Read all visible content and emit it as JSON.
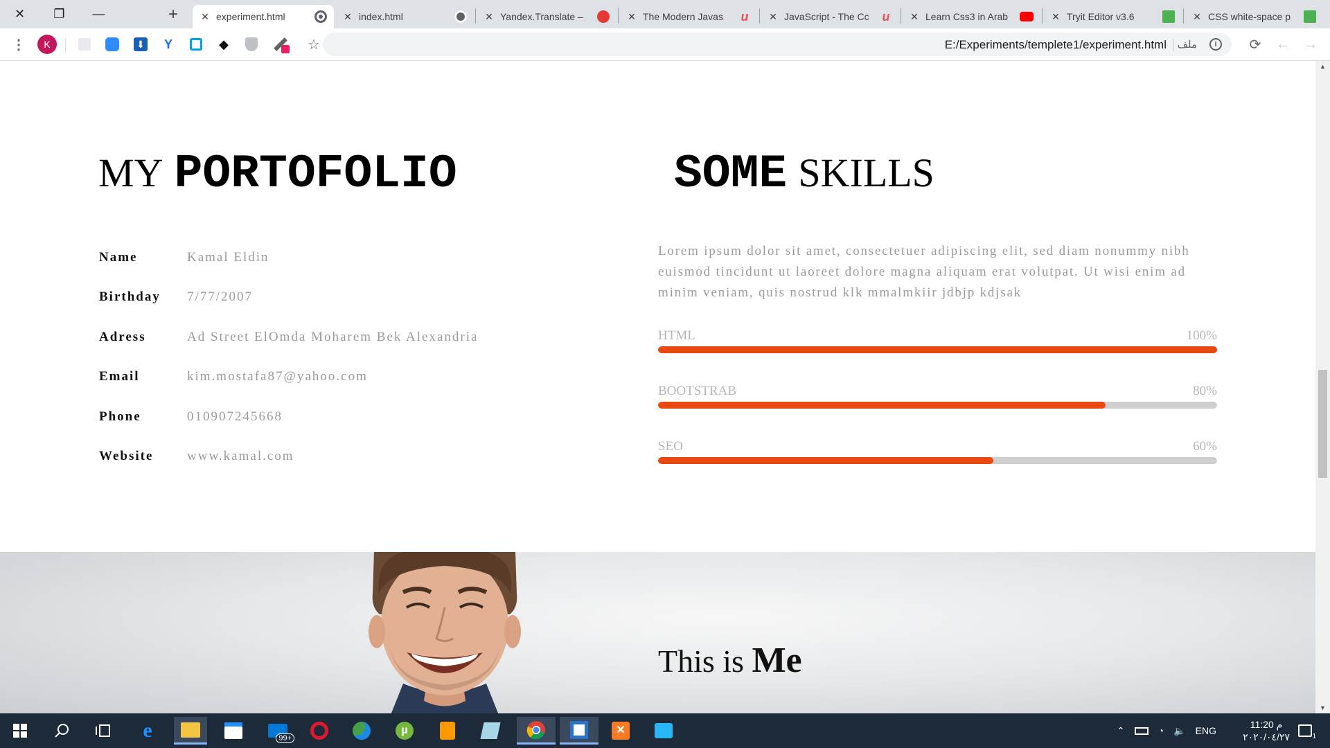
{
  "browser": {
    "window_controls": {
      "close": "✕",
      "restore": "❐",
      "minimize": "—"
    },
    "new_tab": "+",
    "tabs": [
      {
        "title": "experiment.html",
        "active": true
      },
      {
        "title": "index.html",
        "active": false
      },
      {
        "title": "Yandex.Translate –",
        "active": false
      },
      {
        "title": "The Modern Javas",
        "active": false
      },
      {
        "title": "JavaScript - The Cc",
        "active": false
      },
      {
        "title": "Learn Css3 in Arab",
        "active": false
      },
      {
        "title": "Tryit Editor v3.6",
        "active": false
      },
      {
        "title": "CSS white-space p",
        "active": false
      }
    ],
    "profile_initial": "K",
    "url": "E:/Experiments/templete1/experiment.html",
    "url_label": "ملف"
  },
  "page": {
    "portfolio": {
      "heading_light": "MY",
      "heading_bold": "PORTOFOLIO",
      "rows": [
        {
          "label": "Name",
          "value": "Kamal Eldin"
        },
        {
          "label": "Birthday",
          "value": "7/77/2007"
        },
        {
          "label": "Adress",
          "value": "Ad Street ElOmda Moharem Bek Alexandria"
        },
        {
          "label": "Email",
          "value": "kim.mostafa87@yahoo.com"
        },
        {
          "label": "Phone",
          "value": "010907245668"
        },
        {
          "label": "Website",
          "value": "www.kamal.com"
        }
      ]
    },
    "skills": {
      "heading_bold": "SOME",
      "heading_light": "SKILLS",
      "description": "Lorem ipsum dolor sit amet, consectetuer adipiscing elit, sed diam nonummy nibh euismod tincidunt ut laoreet dolore magna aliquam erat volutpat. Ut wisi enim ad minim veniam, quis nostrud klk mmalmkiir jdbjp kdjsak",
      "items": [
        {
          "name": "HTML",
          "percent_label": "100%",
          "percent": 100
        },
        {
          "name": "BOOTSTRAB",
          "percent_label": "80%",
          "percent": 80
        },
        {
          "name": "SEO",
          "percent_label": "60%",
          "percent": 60
        }
      ],
      "bar_color": "#e8490f",
      "track_color": "#cfcfcf"
    },
    "hero": {
      "title_prefix": "This is",
      "title_bold": "Me"
    }
  },
  "taskbar": {
    "lang": "ENG",
    "mail_badge": "99+",
    "time": "11:20 م",
    "date": "٢٠٢٠/٠٤/٢٧",
    "notifications": "1"
  }
}
